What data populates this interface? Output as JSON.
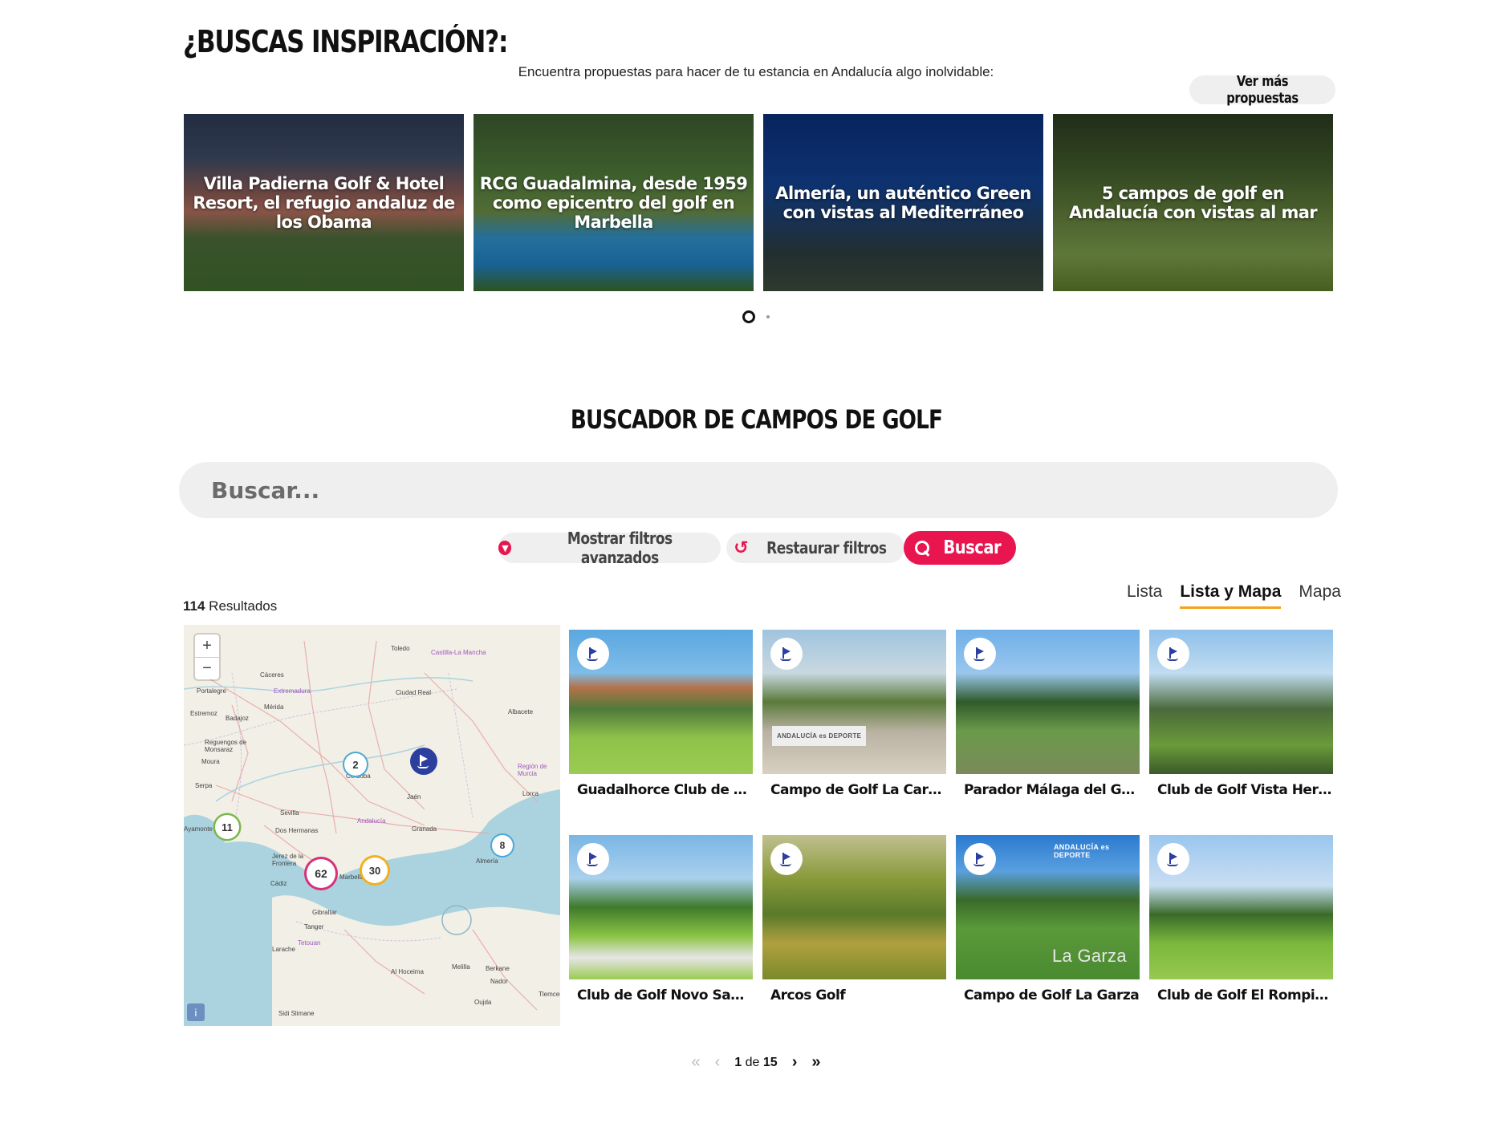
{
  "inspiration": {
    "title": "¿BUSCAS INSPIRACIÓN?:",
    "subtitle": "Encuentra propuestas para hacer de tu estancia en Andalucía algo inolvidable:",
    "more_label": "Ver más propuestas",
    "cards": [
      {
        "title": "Villa Padierna Golf & Hotel Resort, el refugio andaluz de los Obama"
      },
      {
        "title": "RCG Guadalmina, desde 1959 como epicentro del golf en Marbella"
      },
      {
        "title": "Almería, un auténtico Green con vistas al Mediterráneo"
      },
      {
        "title": "5 campos de golf en Andalucía con vistas al mar"
      }
    ]
  },
  "search": {
    "title": "BUSCADOR DE CAMPOS DE GOLF",
    "placeholder": "Buscar...",
    "filters_label": "Mostrar filtros avanzados",
    "reset_label": "Restaurar filtros",
    "search_label": "Buscar"
  },
  "results": {
    "count": "114",
    "label": "Resultados"
  },
  "views": {
    "list": "Lista",
    "list_map": "Lista y Mapa",
    "map": "Mapa",
    "active": "list_map"
  },
  "map": {
    "zoom_in": "+",
    "zoom_out": "−",
    "info": "i",
    "clusters": [
      {
        "label": "2",
        "color": "#4aa8d8"
      },
      {
        "label": "11",
        "color": "#7ab84a"
      },
      {
        "label": "62",
        "color": "#d8307a"
      },
      {
        "label": "30",
        "color": "#f0b020"
      },
      {
        "label": "8",
        "color": "#4aa8d8"
      }
    ],
    "places": [
      "Toledo",
      "Castilla-La Mancha",
      "Cáceres",
      "Extremadura",
      "Portalegre",
      "Ciudad Real",
      "Mérida",
      "Albacete",
      "Estremoz",
      "Badajoz",
      "Córdoba",
      "Reguengos de Monsaraz",
      "Región de Murcia",
      "Moura",
      "Jaén",
      "Serpa",
      "Lorca",
      "Sevilla",
      "Andalucía",
      "Ayamonte",
      "Dos Hermanas",
      "Granada",
      "Almería",
      "Jerez de la Frontera",
      "Cádiz",
      "Marbella",
      "Gibraltar",
      "Tanger",
      "Larache",
      "Al Hoceima",
      "Melilla",
      "Berkane",
      "Oujda",
      "Tetouan",
      "Nador",
      "Sidi Slimane",
      "Tlemcen"
    ]
  },
  "courses": [
    {
      "name": "Guadalhorce Club de Golf"
    },
    {
      "name": "Campo de Golf La Cartuja",
      "brand": "ANDALUCÍA es DEPORTE"
    },
    {
      "name": "Parador Málaga del Golf"
    },
    {
      "name": "Club de Golf Vista Hermosa"
    },
    {
      "name": "Club de Golf Novo Sancti Petri"
    },
    {
      "name": "Arcos Golf"
    },
    {
      "name": "Campo de Golf La Garza",
      "brand": "ANDALUCÍA es DEPORTE",
      "overlay": "La Garza"
    },
    {
      "name": "Club de Golf El Rompido"
    }
  ],
  "pagination": {
    "current": "1",
    "of": "de",
    "total": "15"
  }
}
